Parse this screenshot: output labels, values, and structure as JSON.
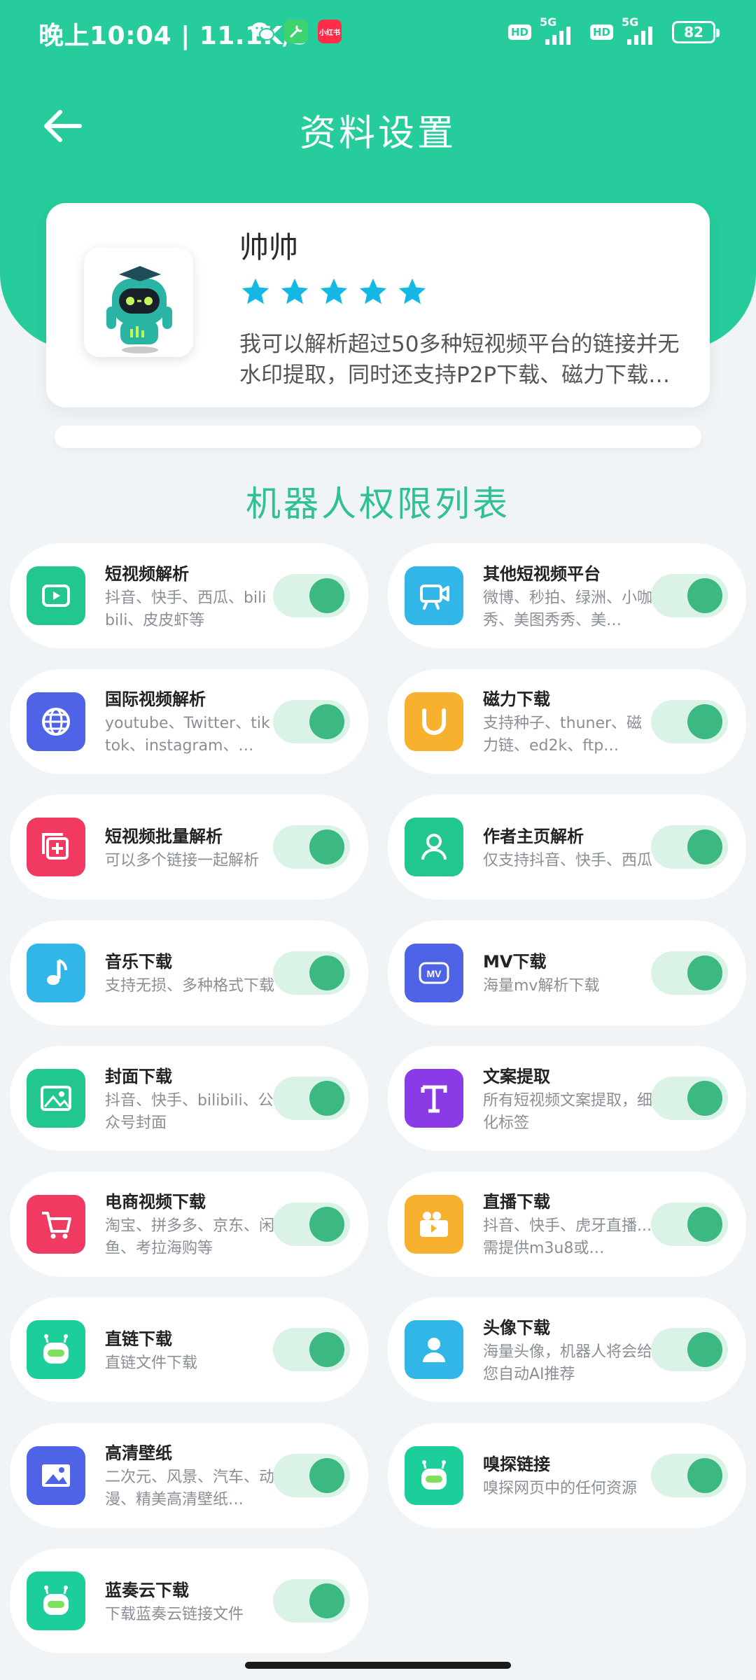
{
  "status_bar": {
    "time": "晚上10:04 | 11.1K/s",
    "app_label": "小红书",
    "network": "5G",
    "hd": "HD",
    "battery": "82"
  },
  "header": {
    "title": "资料设置"
  },
  "profile": {
    "name": "帅帅",
    "rating": 5,
    "description": "我可以解析超过50多种短视频平台的链接并无水印提取，同时还支持P2P下载、磁力下载…"
  },
  "permissions": {
    "heading": "机器人权限列表",
    "items": [
      {
        "title": "短视频解析",
        "desc": "抖音、快手、西瓜、bilibili、皮皮虾等",
        "icon": "video-play-icon",
        "color": "#22c78e",
        "enabled": true
      },
      {
        "title": "其他短视频平台",
        "desc": "微博、秒拍、绿洲、小咖秀、美图秀秀、美…",
        "icon": "camera-icon",
        "color": "#32b6e8",
        "enabled": true
      },
      {
        "title": "国际视频解析",
        "desc": "youtube、Twitter、tiktok、instagram、…",
        "icon": "globe-icon",
        "color": "#4f63e6",
        "enabled": true
      },
      {
        "title": "磁力下载",
        "desc": "支持种子、thuner、磁力链、ed2k、ftp…",
        "icon": "magnet-icon",
        "color": "#f7b12e",
        "enabled": true
      },
      {
        "title": "短视频批量解析",
        "desc": "可以多个链接一起解析",
        "icon": "batch-add-icon",
        "color": "#f03a62",
        "enabled": true
      },
      {
        "title": "作者主页解析",
        "desc": "仅支持抖音、快手、西瓜",
        "icon": "user-icon",
        "color": "#22c78e",
        "enabled": true
      },
      {
        "title": "音乐下载",
        "desc": "支持无损、多种格式下载",
        "icon": "music-note-icon",
        "color": "#32b6e8",
        "enabled": true
      },
      {
        "title": "MV下载",
        "desc": "海量mv解析下载",
        "icon": "mv-icon",
        "color": "#4f63e6",
        "enabled": true
      },
      {
        "title": "封面下载",
        "desc": "抖音、快手、bilibili、公众号封面",
        "icon": "image-icon",
        "color": "#22c78e",
        "enabled": true
      },
      {
        "title": "文案提取",
        "desc": "所有短视频文案提取，细化标签",
        "icon": "text-icon",
        "color": "#8a3be6",
        "enabled": true
      },
      {
        "title": "电商视频下载",
        "desc": "淘宝、拼多多、京东、闲鱼、考拉海购等",
        "icon": "cart-icon",
        "color": "#f03a62",
        "enabled": true
      },
      {
        "title": "直播下载",
        "desc": "抖音、快手、虎牙直播...需提供m3u8或…",
        "icon": "live-camera-icon",
        "color": "#f7b12e",
        "enabled": true
      },
      {
        "title": "直链下载",
        "desc": "直链文件下载",
        "icon": "robot-icon",
        "color": "#1ccf9a",
        "enabled": true
      },
      {
        "title": "头像下载",
        "desc": "海量头像，机器人将会给您自动AI推荐",
        "icon": "avatar-icon",
        "color": "#32b6e8",
        "enabled": true
      },
      {
        "title": "高清壁纸",
        "desc": "二次元、风景、汽车、动漫、精美高清壁纸…",
        "icon": "picture-icon",
        "color": "#4f63e6",
        "enabled": true
      },
      {
        "title": "嗅探链接",
        "desc": "嗅探网页中的任何资源",
        "icon": "robot-icon",
        "color": "#1ccf9a",
        "enabled": true
      },
      {
        "title": "蓝奏云下载",
        "desc": "下载蓝奏云链接文件",
        "icon": "robot-icon",
        "color": "#1ccf9a",
        "enabled": true
      }
    ]
  }
}
